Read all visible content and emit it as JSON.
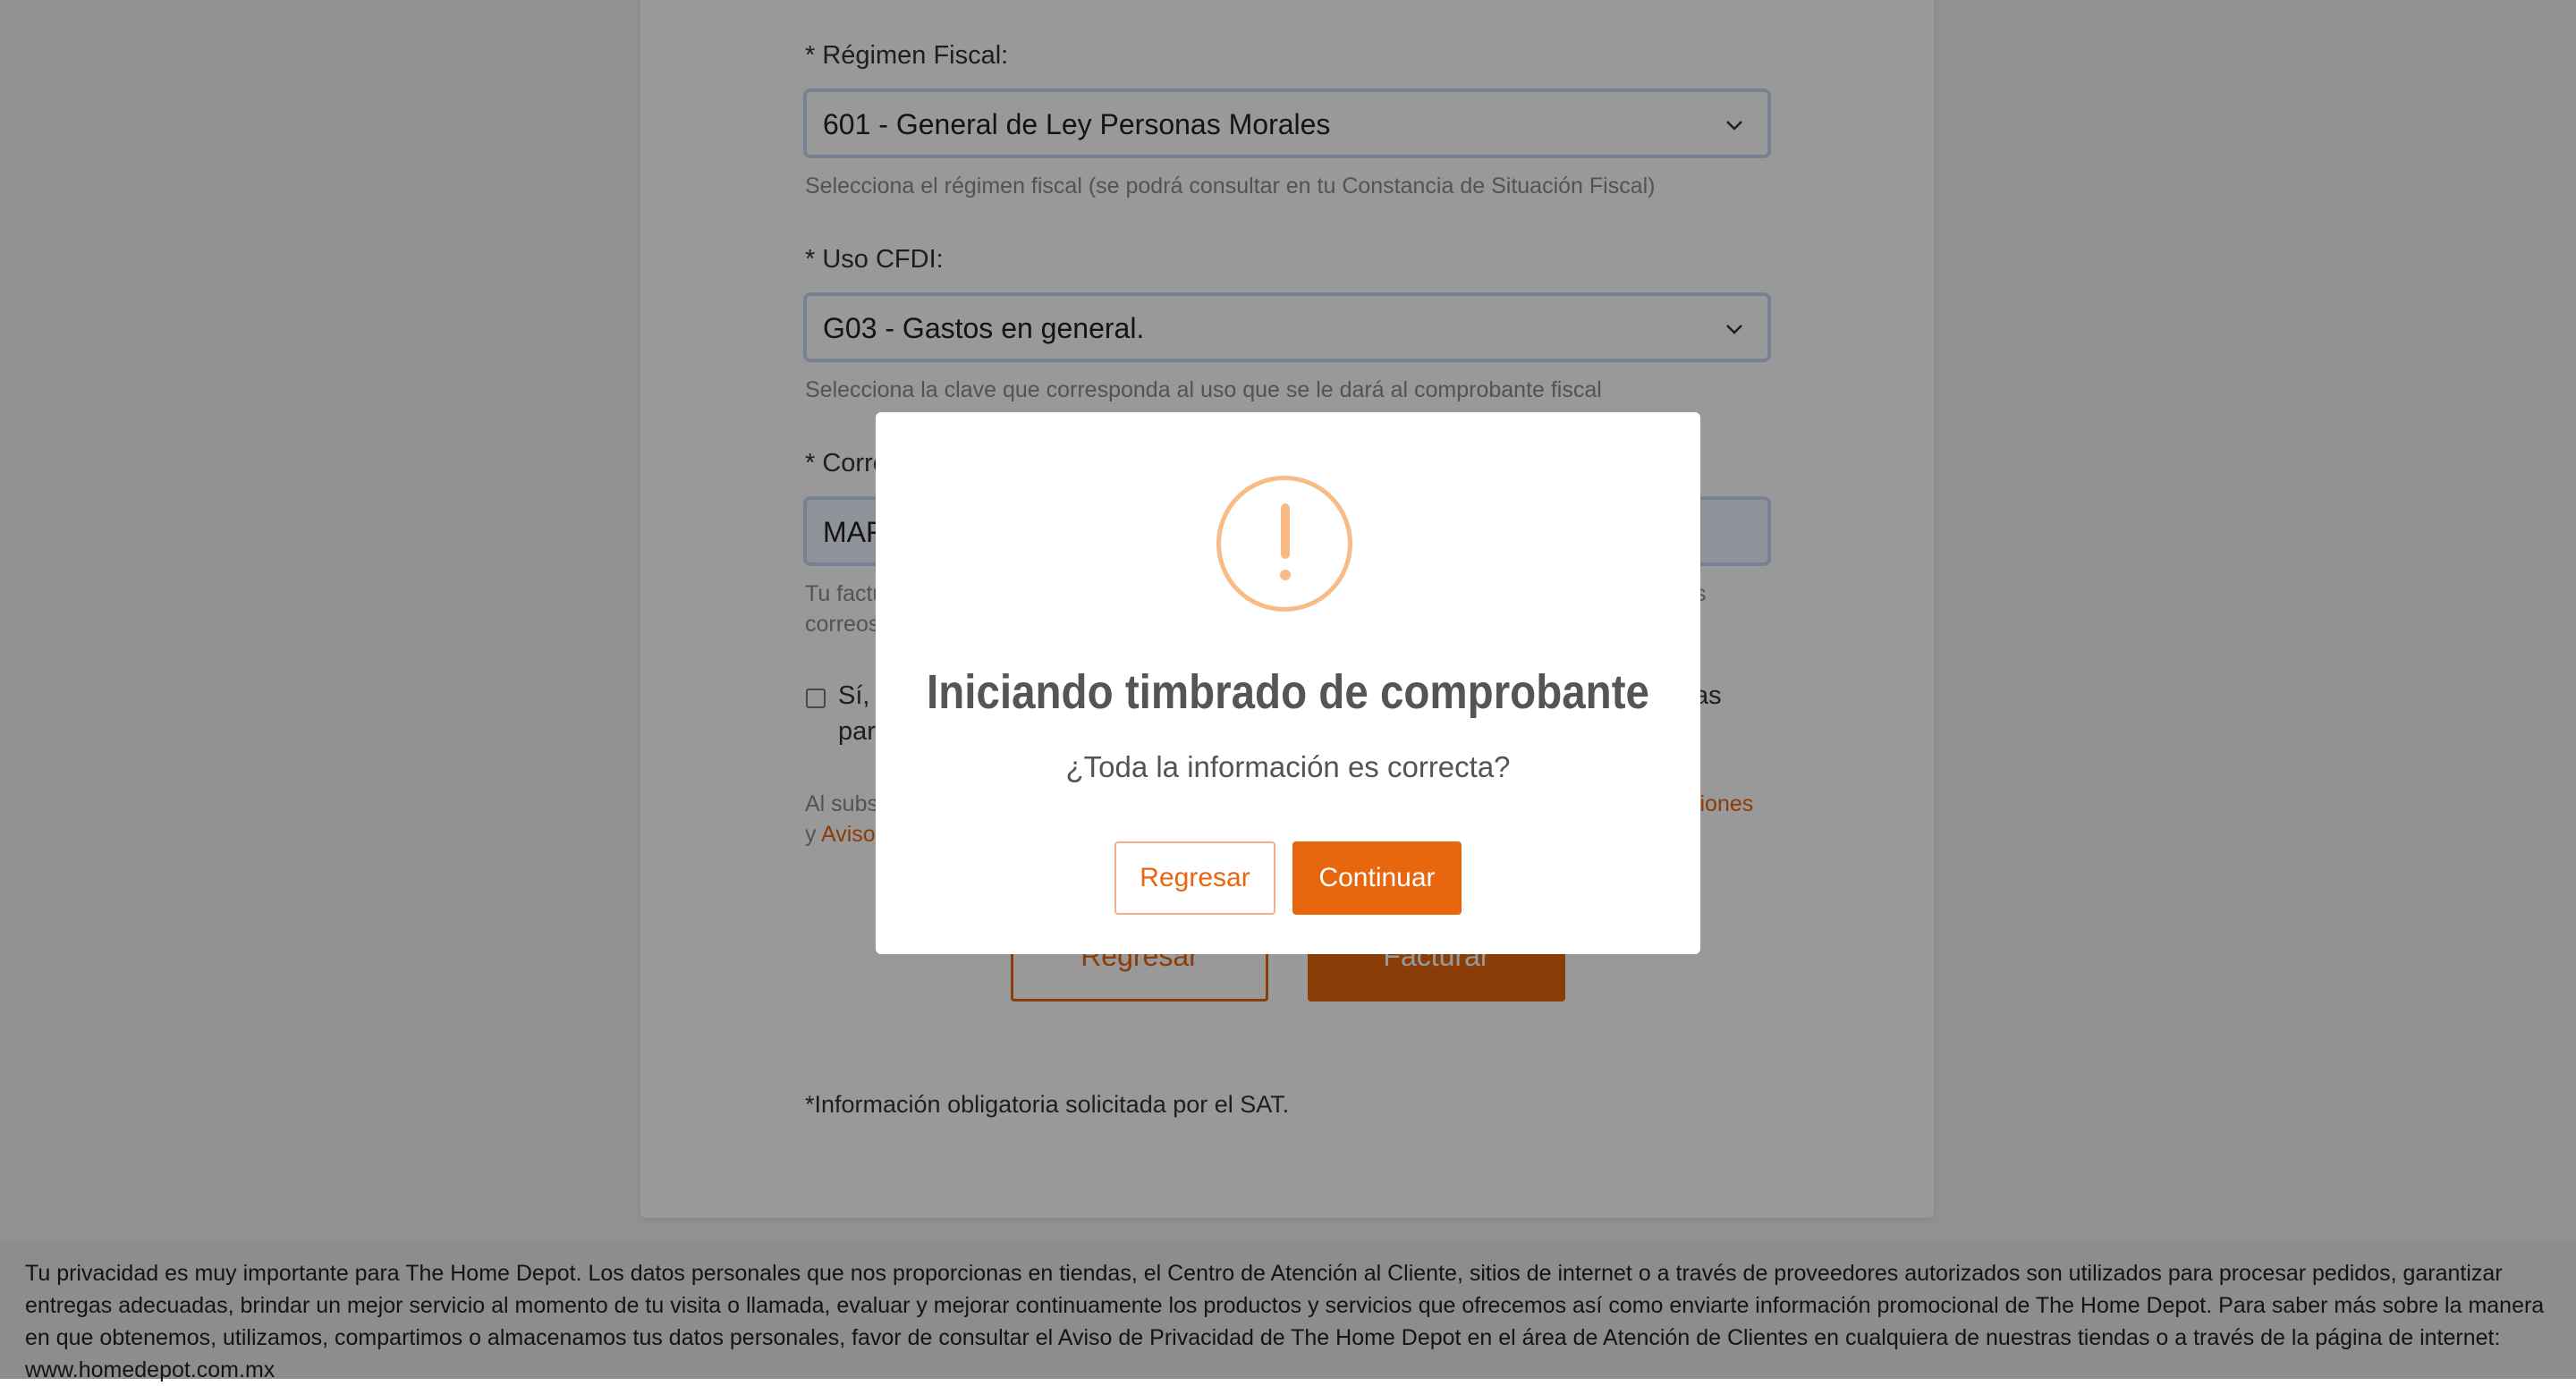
{
  "form": {
    "regimen_label": "* Régimen Fiscal:",
    "regimen_value": "601 - General de Ley Personas Morales",
    "regimen_help": "Selecciona el régimen fiscal (se podrá consultar en tu Constancia de Situación Fiscal)",
    "uso_label": "* Uso CFDI:",
    "uso_value": "G03 - Gastos en general.",
    "uso_help": "Selecciona la clave que corresponda al uso que se le dará al comprobante fiscal",
    "correo_label": "* Corre",
    "correo_value": "MAF",
    "correo_help_line1_left": "Tu factu",
    "correo_help_line1_right": "s",
    "correo_help_line2": "correos",
    "checkbox_line1_left": "Sí,",
    "checkbox_line1_right": "as",
    "checkbox_line2": "par",
    "legal_line1_left": "Al subs",
    "legal_line1_link": "ciones",
    "legal_line2_prefix": "y",
    "legal_line2_link": "Aviso",
    "back_button": "Regresar",
    "submit_button": "Facturar",
    "required_note": "*Información obligatoria solicitada por el SAT."
  },
  "footer": {
    "privacy_text": "Tu privacidad es muy importante para The Home Depot. Los datos personales que nos proporcionas en tiendas, el Centro de Atención al Cliente, sitios de internet o a través de proveedores autorizados son utilizados para procesar pedidos, garantizar entregas adecuadas, brindar un mejor servicio al momento de tu visita o llamada, evaluar y mejorar continuamente los productos y servicios que ofrecemos así como enviarte información promocional de The Home Depot. Para saber más sobre la manera en que obtenemos, utilizamos, compartimos o almacenamos tus datos personales, favor de consultar el Aviso de Privacidad de The Home Depot en el área de Atención de Clientes en cualquiera de nuestras tiendas o a través de la página de internet: www.homedepot.com.mx"
  },
  "modal": {
    "icon": "exclamation-warning-icon",
    "title": "Iniciando timbrado de comprobante",
    "text": "¿Toda la información es correcta?",
    "back_button": "Regresar",
    "continue_button": "Continuar"
  },
  "colors": {
    "accent": "#e8660e",
    "warning_icon": "#f8bb86",
    "overlay": "rgba(0,0,0,0.4)"
  }
}
